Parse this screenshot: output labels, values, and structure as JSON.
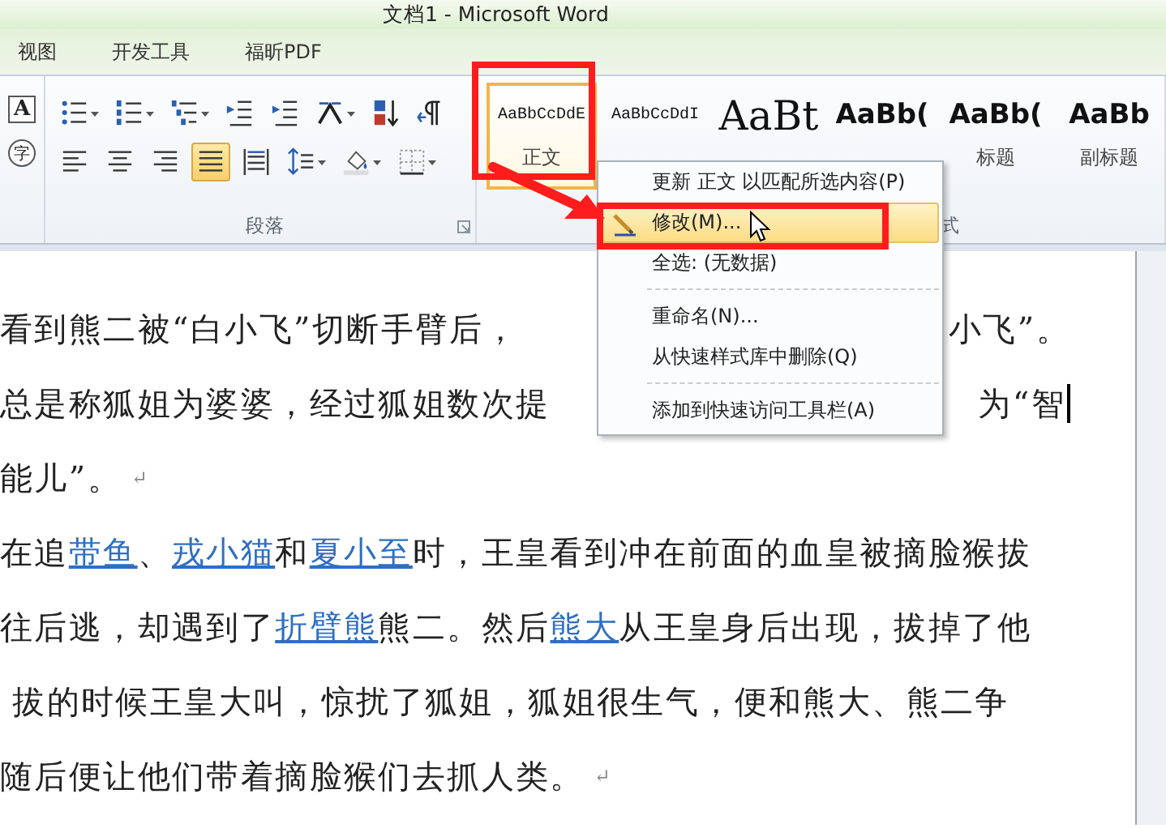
{
  "window": {
    "title": "文档1 - Microsoft Word"
  },
  "tabs": [
    {
      "label": "视图",
      "selected": false
    },
    {
      "label": "开发工具",
      "selected": false
    },
    {
      "label": "福昕PDF",
      "selected": false
    }
  ],
  "font_tools": [
    {
      "kind": "boxed",
      "label": "A"
    },
    {
      "kind": "enclosed",
      "label": "字"
    }
  ],
  "paragraph_group": {
    "label": "段落",
    "row1": [
      {
        "kind": "bullets",
        "selected": false
      },
      {
        "kind": "numbering",
        "selected": false
      },
      {
        "kind": "multilevel",
        "selected": false
      },
      {
        "kind": "outdent",
        "selected": false
      },
      {
        "kind": "indent",
        "selected": false
      },
      {
        "kind": "asian-layout",
        "selected": false
      },
      {
        "kind": "sort",
        "selected": false
      },
      {
        "kind": "show-marks",
        "selected": false
      }
    ],
    "row2": [
      {
        "kind": "align-left",
        "selected": false
      },
      {
        "kind": "align-center",
        "selected": false
      },
      {
        "kind": "align-right",
        "selected": false
      },
      {
        "kind": "justify",
        "selected": true
      },
      {
        "kind": "distribute",
        "selected": false
      },
      {
        "kind": "line-spacing",
        "selected": false
      },
      {
        "kind": "shading",
        "selected": false
      },
      {
        "kind": "borders",
        "selected": false
      }
    ]
  },
  "styles_group": {
    "label": "式",
    "styles": [
      {
        "sample": "AaBbCcDdE",
        "label": "正文",
        "kind": "mono",
        "selected": true
      },
      {
        "sample": "AaBbCcDdI",
        "kind": "mono",
        "selected": false
      },
      {
        "sample": "AaBt",
        "kind": "large",
        "selected": false
      },
      {
        "sample": "AaBb(",
        "kind": "bold",
        "selected": false
      },
      {
        "sample": "AaBb(",
        "label": "标题",
        "kind": "bold",
        "selected": false
      },
      {
        "sample": "AaBb",
        "label": "副标题",
        "kind": "bold",
        "selected": false
      }
    ]
  },
  "context_menu": {
    "items": [
      {
        "kind": "item",
        "label": "更新 正文 以匹配所选内容(P)",
        "highlighted": false
      },
      {
        "kind": "icon-item",
        "label": "修改(M)...",
        "highlighted": true
      },
      {
        "kind": "item",
        "label": "全选: (无数据)",
        "highlighted": false
      },
      {
        "kind": "separator"
      },
      {
        "kind": "item",
        "label": "重命名(N)...",
        "highlighted": false
      },
      {
        "kind": "item",
        "label": "从快速样式库中删除(Q)",
        "highlighted": false
      },
      {
        "kind": "separator"
      },
      {
        "kind": "item",
        "label": "添加到快速访问工具栏(A)",
        "highlighted": false
      }
    ]
  },
  "document": {
    "lines": [
      {
        "left": [
          {
            "text": "看到熊二被“白小飞”切断手臂后，",
            "link": false
          }
        ],
        "right": [
          {
            "text": "小飞”。",
            "link": false
          }
        ],
        "cursor": false
      },
      {
        "left": [
          {
            "text": "总是称狐姐为婆婆，经过狐姐数次提",
            "link": false
          }
        ],
        "right": [
          {
            "text": "为“智",
            "link": false
          }
        ],
        "cursor": true
      },
      {
        "left": [
          {
            "text": "能儿”。",
            "link": false
          }
        ],
        "end_mark": "↵",
        "cursor": false
      },
      {
        "left": [
          {
            "text": "在追",
            "link": false
          },
          {
            "text": "带鱼",
            "link": true
          },
          {
            "text": "、",
            "link": false
          },
          {
            "text": "戎小猫",
            "link": true
          },
          {
            "text": "和",
            "link": false
          },
          {
            "text": "夏小至",
            "link": true
          },
          {
            "text": "时，王皇看到冲在前面的血皇被摘脸猴拔",
            "link": false
          }
        ],
        "cursor": false
      },
      {
        "left": [
          {
            "text": "往后逃，却遇到了",
            "link": false
          },
          {
            "text": "折臂熊",
            "link": true
          },
          {
            "text": "熊二。然后",
            "link": false
          },
          {
            "text": "熊大",
            "link": true
          },
          {
            "text": "从王皇身后出现，拔掉了他",
            "link": false
          }
        ],
        "cursor": false
      },
      {
        "left": [
          {
            "text": " 拔的时候王皇大叫，惊扰了狐姐，狐姐很生气，便和熊大、熊二争",
            "link": false
          }
        ],
        "cursor": false
      },
      {
        "left": [
          {
            "text": "随后便让他们带着摘脸猴们去抓人类。",
            "link": false
          }
        ],
        "end_mark": "↵",
        "cursor": false
      }
    ]
  }
}
